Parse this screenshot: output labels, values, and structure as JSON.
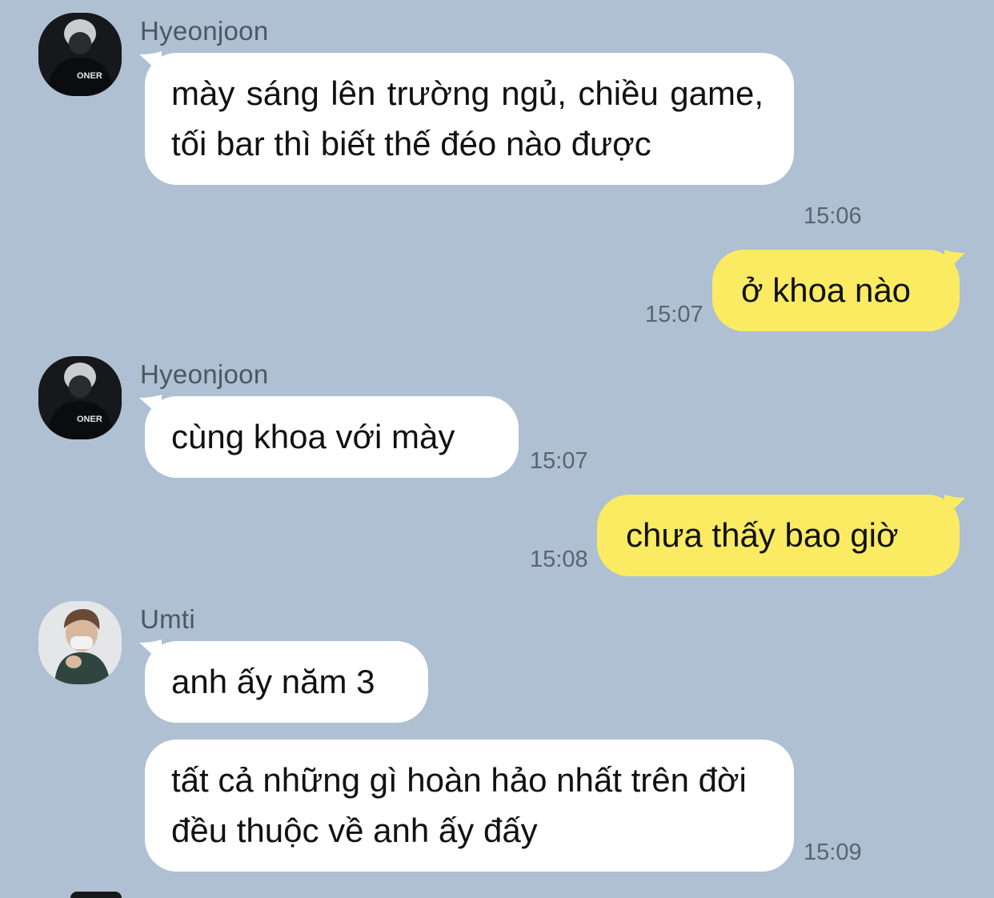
{
  "colors": {
    "background": "#aec0d2",
    "incoming_bubble": "#ffffff",
    "outgoing_bubble": "#fbeb63",
    "meta_text": "#5a6470"
  },
  "messages": [
    {
      "direction": "incoming",
      "sender": "Hyeonjoon",
      "avatar": "avatar-hyeonjoon-icon",
      "text": "mày sáng lên trường ngủ, chiều game, tối bar thì biết thế đéo nào được",
      "time": "15:06"
    },
    {
      "direction": "outgoing",
      "text": "ở khoa nào",
      "time": "15:07"
    },
    {
      "direction": "incoming",
      "sender": "Hyeonjoon",
      "avatar": "avatar-hyeonjoon-icon",
      "text": "cùng khoa với mày",
      "time": "15:07"
    },
    {
      "direction": "outgoing",
      "text": "chưa thấy bao giờ",
      "time": "15:08"
    },
    {
      "direction": "incoming",
      "sender": "Umti",
      "avatar": "avatar-umti-icon",
      "text": "anh ấy năm 3",
      "time": ""
    },
    {
      "direction": "incoming",
      "text": "tất cả những gì hoàn hảo nhất trên đời đều thuộc về anh ấy đấy",
      "time": "15:09"
    }
  ]
}
